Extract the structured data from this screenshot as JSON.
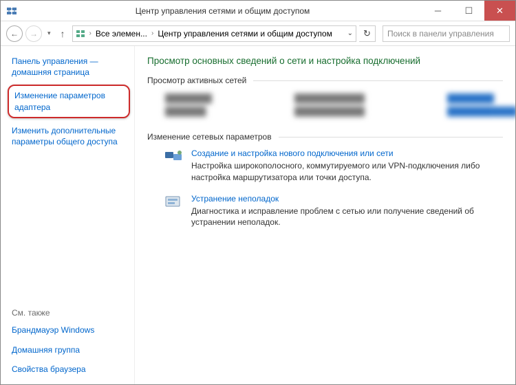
{
  "titlebar": {
    "title": "Центр управления сетями и общим доступом"
  },
  "navbar": {
    "crumb1": "Все элемен...",
    "crumb2": "Центр управления сетями и общим доступом",
    "search_placeholder": "Поиск в панели управления"
  },
  "sidebar": {
    "home": "Панель управления — домашняя страница",
    "adapter": "Изменение параметров адаптера",
    "sharing": "Изменить дополнительные параметры общего доступа",
    "see_also": "См. также",
    "firewall": "Брандмауэр Windows",
    "homegroup": "Домашняя группа",
    "browser": "Свойства браузера"
  },
  "main": {
    "title": "Просмотр основных сведений о сети и настройка подключений",
    "active_section": "Просмотр активных сетей",
    "settings_section": "Изменение сетевых параметров",
    "task1": {
      "title": "Создание и настройка нового подключения или сети",
      "desc": "Настройка широкополосного, коммутируемого или VPN-подключения либо настройка маршрутизатора или точки доступа."
    },
    "task2": {
      "title": "Устранение неполадок",
      "desc": "Диагностика и исправление проблем с сетью или получение сведений об устранении неполадок."
    }
  }
}
